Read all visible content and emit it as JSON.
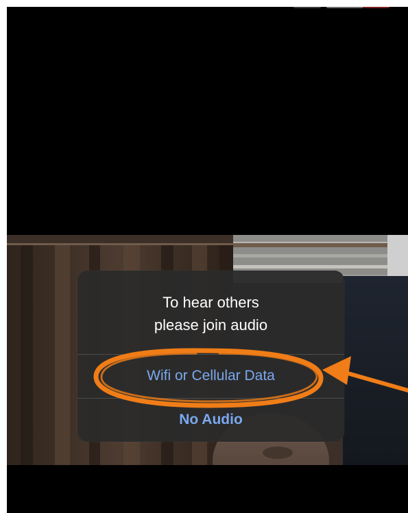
{
  "dialog": {
    "title_line1": "To hear others",
    "title_line2": "please join audio",
    "options": [
      {
        "label": "Wifi or Cellular Data"
      },
      {
        "label": "No Audio"
      }
    ]
  },
  "colors": {
    "screen_background": "#000000",
    "dialog_background": "#2a2a2a",
    "dialog_title_text": "#ffffff",
    "option_text": "#7aa9ef",
    "annotation": "#f07d17"
  }
}
